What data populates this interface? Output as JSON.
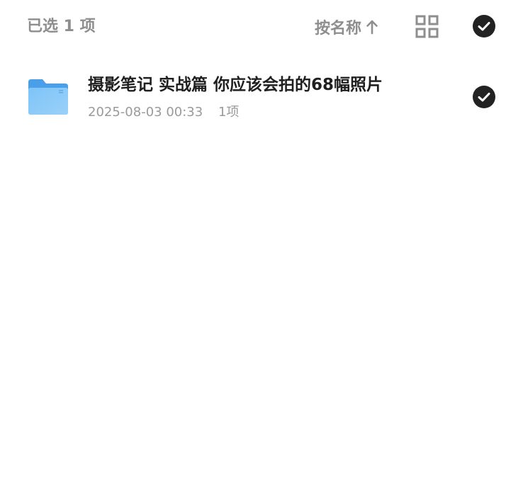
{
  "toolbar": {
    "selected_count_label": "已选 1 项",
    "sort_label": "按名称",
    "sort_direction_icon": "arrow-up-icon",
    "view_toggle_icon": "grid-view-icon",
    "select_all_icon": "check-circle-icon"
  },
  "files": [
    {
      "name": "摄影笔记 实战篇 你应该会拍的68幅照片",
      "modified": "2025-08-03 00:33",
      "item_count": "1项",
      "icon": "folder-icon",
      "selected": true
    }
  ],
  "colors": {
    "folder_blue": "#6cb8f5",
    "check_bg": "#222222",
    "muted_text": "#8e8e8e",
    "primary_text": "#1f1f1f"
  }
}
